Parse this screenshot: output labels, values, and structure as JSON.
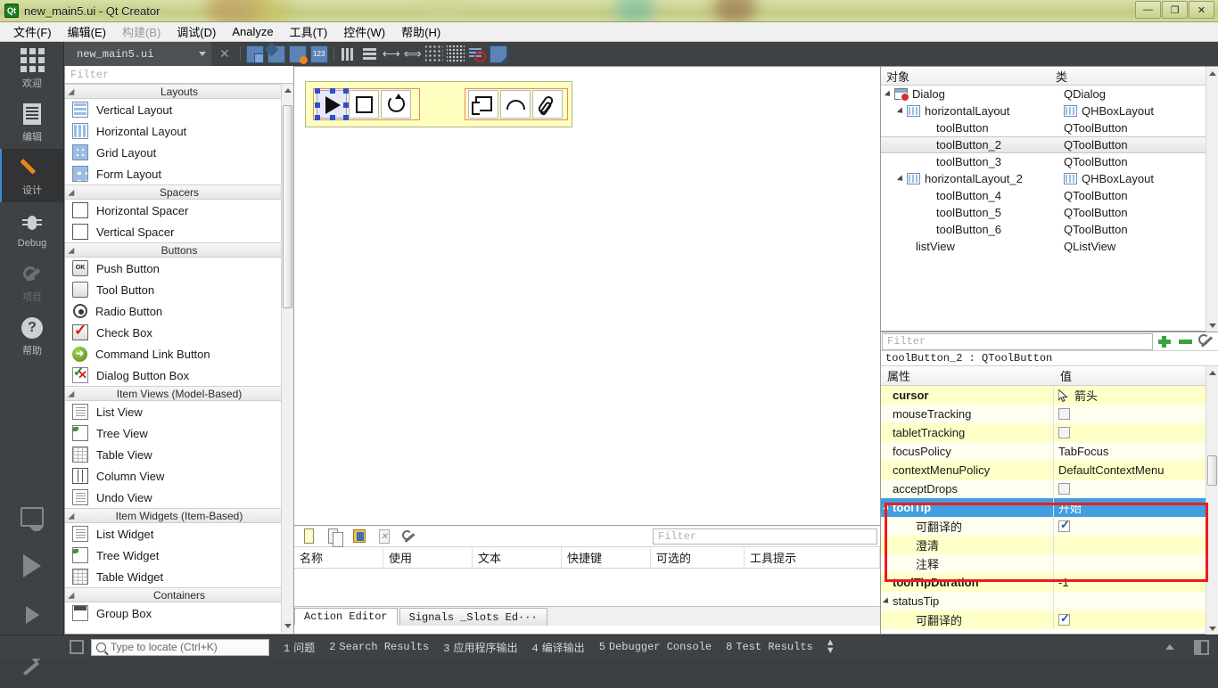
{
  "window": {
    "title": "new_main5.ui - Qt Creator",
    "app_icon_text": "Qt",
    "buttons": [
      {
        "name": "minimize",
        "glyph": "—"
      },
      {
        "name": "restore",
        "glyph": "❐"
      },
      {
        "name": "close",
        "glyph": "✕"
      }
    ]
  },
  "menubar": {
    "items": [
      {
        "label": "文件(F)",
        "disabled": false
      },
      {
        "label": "编辑(E)",
        "disabled": false
      },
      {
        "label": "构建(B)",
        "disabled": true
      },
      {
        "label": "调试(D)",
        "disabled": false
      },
      {
        "label": "Analyze",
        "disabled": false
      },
      {
        "label": "工具(T)",
        "disabled": false
      },
      {
        "label": "控件(W)",
        "disabled": false
      },
      {
        "label": "帮助(H)",
        "disabled": false
      }
    ]
  },
  "modebar": {
    "items": [
      {
        "label": "欢迎",
        "icon": "grid-icon",
        "active": false,
        "disabled": false
      },
      {
        "label": "编辑",
        "icon": "document-icon",
        "active": false,
        "disabled": false
      },
      {
        "label": "设计",
        "icon": "pencil-icon",
        "active": true,
        "disabled": false
      },
      {
        "label": "Debug",
        "icon": "bug-icon",
        "active": false,
        "disabled": false
      },
      {
        "label": "项目",
        "icon": "wrench-icon",
        "active": false,
        "disabled": true
      },
      {
        "label": "帮助",
        "icon": "question-icon",
        "active": false,
        "disabled": false
      }
    ],
    "run_items": [
      {
        "name": "kit-selector",
        "icon": "monitor-icon"
      },
      {
        "name": "run",
        "icon": "play-icon"
      },
      {
        "name": "debug",
        "icon": "play-bug-icon"
      },
      {
        "name": "build",
        "icon": "hammer-icon"
      }
    ]
  },
  "editor_tabbar": {
    "current_file": "new_main5.ui",
    "close_glyph": "✕",
    "tools": [
      {
        "name": "edit-widgets",
        "icon": "edit-widgets-icon"
      },
      {
        "name": "edit-signals-slots",
        "icon": "signals-slots-icon"
      },
      {
        "name": "edit-buddies",
        "icon": "buddies-icon"
      },
      {
        "name": "edit-tab-order",
        "icon": "tab-order-icon"
      },
      {
        "name": "layout-horizontally",
        "icon": "layout-horizontal-icon"
      },
      {
        "name": "layout-vertically",
        "icon": "layout-vertical-icon"
      },
      {
        "name": "layout-horizontal-splitter",
        "icon": "h-splitter-icon"
      },
      {
        "name": "layout-vertical-splitter",
        "icon": "v-splitter-icon"
      },
      {
        "name": "layout-form",
        "icon": "form-layout-icon"
      },
      {
        "name": "layout-grid",
        "icon": "grid-layout-icon"
      },
      {
        "name": "break-layout",
        "icon": "break-layout-icon"
      },
      {
        "name": "adjust-size",
        "icon": "adjust-size-icon"
      }
    ]
  },
  "widgetbox": {
    "filter_placeholder": "Filter",
    "groups": [
      {
        "title": "Layouts",
        "items": [
          {
            "label": "Vertical Layout",
            "icon": "vertical-layout-icon"
          },
          {
            "label": "Horizontal Layout",
            "icon": "horizontal-layout-icon"
          },
          {
            "label": "Grid Layout",
            "icon": "grid-layout-icon"
          },
          {
            "label": "Form Layout",
            "icon": "form-layout-icon"
          }
        ]
      },
      {
        "title": "Spacers",
        "items": [
          {
            "label": "Horizontal Spacer",
            "icon": "horizontal-spacer-icon"
          },
          {
            "label": "Vertical Spacer",
            "icon": "vertical-spacer-icon"
          }
        ]
      },
      {
        "title": "Buttons",
        "items": [
          {
            "label": "Push Button",
            "icon": "push-button-icon"
          },
          {
            "label": "Tool Button",
            "icon": "tool-button-icon"
          },
          {
            "label": "Radio Button",
            "icon": "radio-button-icon"
          },
          {
            "label": "Check Box",
            "icon": "check-box-icon"
          },
          {
            "label": "Command Link Button",
            "icon": "command-link-icon"
          },
          {
            "label": "Dialog Button Box",
            "icon": "dialog-button-box-icon"
          }
        ]
      },
      {
        "title": "Item Views (Model-Based)",
        "items": [
          {
            "label": "List View",
            "icon": "list-view-icon"
          },
          {
            "label": "Tree View",
            "icon": "tree-view-icon"
          },
          {
            "label": "Table View",
            "icon": "table-view-icon"
          },
          {
            "label": "Column View",
            "icon": "column-view-icon"
          },
          {
            "label": "Undo View",
            "icon": "undo-view-icon"
          }
        ]
      },
      {
        "title": "Item Widgets (Item-Based)",
        "items": [
          {
            "label": "List Widget",
            "icon": "list-widget-icon"
          },
          {
            "label": "Tree Widget",
            "icon": "tree-widget-icon"
          },
          {
            "label": "Table Widget",
            "icon": "table-widget-icon"
          }
        ]
      },
      {
        "title": "Containers",
        "items": [
          {
            "label": "Group Box",
            "icon": "group-box-icon"
          }
        ]
      }
    ]
  },
  "form": {
    "group1": [
      {
        "name": "toolButton",
        "icon": "play-icon",
        "selected": true
      },
      {
        "name": "toolButton_2",
        "icon": "stop-square-icon",
        "selected": false
      },
      {
        "name": "toolButton_3",
        "icon": "reload-icon",
        "selected": false
      }
    ],
    "group2": [
      {
        "name": "toolButton_4",
        "icon": "window-icon",
        "selected": false
      },
      {
        "name": "toolButton_5",
        "icon": "cloud-icon",
        "selected": false
      },
      {
        "name": "toolButton_6",
        "icon": "paperclip-icon",
        "selected": false
      }
    ]
  },
  "object_inspector": {
    "headers": [
      "对象",
      "类"
    ],
    "rows": [
      {
        "object": "Dialog",
        "class": "QDialog",
        "indent": 0,
        "expandable": true,
        "icon": "dialog-icon",
        "class_icon": "",
        "selected": false
      },
      {
        "object": "horizontalLayout",
        "class": "QHBoxLayout",
        "indent": 1,
        "expandable": true,
        "icon": "hbox-icon",
        "class_icon": "hbox-icon",
        "selected": false
      },
      {
        "object": "toolButton",
        "class": "QToolButton",
        "indent": 2,
        "expandable": false,
        "icon": "",
        "class_icon": "",
        "selected": false
      },
      {
        "object": "toolButton_2",
        "class": "QToolButton",
        "indent": 2,
        "expandable": false,
        "icon": "",
        "class_icon": "",
        "selected": true
      },
      {
        "object": "toolButton_3",
        "class": "QToolButton",
        "indent": 2,
        "expandable": false,
        "icon": "",
        "class_icon": "",
        "selected": false
      },
      {
        "object": "horizontalLayout_2",
        "class": "QHBoxLayout",
        "indent": 1,
        "expandable": true,
        "icon": "hbox-icon",
        "class_icon": "hbox-icon",
        "selected": false
      },
      {
        "object": "toolButton_4",
        "class": "QToolButton",
        "indent": 2,
        "expandable": false,
        "icon": "",
        "class_icon": "",
        "selected": false
      },
      {
        "object": "toolButton_5",
        "class": "QToolButton",
        "indent": 2,
        "expandable": false,
        "icon": "",
        "class_icon": "",
        "selected": false
      },
      {
        "object": "toolButton_6",
        "class": "QToolButton",
        "indent": 2,
        "expandable": false,
        "icon": "",
        "class_icon": "",
        "selected": false
      },
      {
        "object": "listView",
        "class": "QListView",
        "indent": 1,
        "expandable": false,
        "icon": "",
        "class_icon": "",
        "selected": false
      }
    ]
  },
  "property_editor": {
    "filter_placeholder": "Filter",
    "object_line": "toolButton_2 : QToolButton",
    "headers": [
      "属性",
      "值"
    ],
    "toolbar": [
      {
        "name": "add-property",
        "icon": "plus-icon"
      },
      {
        "name": "remove-property",
        "icon": "minus-icon"
      },
      {
        "name": "configure",
        "icon": "wrench-icon"
      }
    ],
    "rows": [
      {
        "name": "cursor",
        "value": "箭头",
        "indent": 0,
        "bold": true,
        "expandable": false,
        "type": "cursor",
        "band": "yellow"
      },
      {
        "name": "mouseTracking",
        "value": "",
        "indent": 0,
        "bold": false,
        "expandable": false,
        "type": "checkbox",
        "checked": false,
        "band": "pale"
      },
      {
        "name": "tabletTracking",
        "value": "",
        "indent": 0,
        "bold": false,
        "expandable": false,
        "type": "checkbox",
        "checked": false,
        "band": "yellow"
      },
      {
        "name": "focusPolicy",
        "value": "TabFocus",
        "indent": 0,
        "bold": false,
        "expandable": false,
        "type": "text",
        "band": "pale"
      },
      {
        "name": "contextMenuPolicy",
        "value": "DefaultContextMenu",
        "indent": 0,
        "bold": false,
        "expandable": false,
        "type": "text",
        "band": "yellow"
      },
      {
        "name": "acceptDrops",
        "value": "",
        "indent": 0,
        "bold": false,
        "expandable": false,
        "type": "checkbox",
        "checked": false,
        "band": "pale"
      },
      {
        "name": "toolTip",
        "value": "开始",
        "indent": 0,
        "bold": true,
        "expandable": true,
        "type": "text",
        "band": "selected"
      },
      {
        "name": "可翻译的",
        "value": "",
        "indent": 1,
        "bold": false,
        "expandable": false,
        "type": "checkbox",
        "checked": true,
        "band": "pale"
      },
      {
        "name": "澄清",
        "value": "",
        "indent": 1,
        "bold": false,
        "expandable": false,
        "type": "text",
        "band": "yellow"
      },
      {
        "name": "注释",
        "value": "",
        "indent": 1,
        "bold": false,
        "expandable": false,
        "type": "text",
        "band": "pale"
      },
      {
        "name": "toolTipDuration",
        "value": "-1",
        "indent": 0,
        "bold": true,
        "expandable": false,
        "type": "text",
        "band": "yellow"
      },
      {
        "name": "statusTip",
        "value": "",
        "indent": 0,
        "bold": false,
        "expandable": true,
        "type": "text",
        "band": "pale"
      },
      {
        "name": "可翻译的",
        "value": "",
        "indent": 1,
        "bold": false,
        "expandable": false,
        "type": "checkbox",
        "checked": true,
        "band": "yellow"
      }
    ],
    "highlight_color": "#ee1c1c",
    "selection_color": "#3f9fe0"
  },
  "action_editor": {
    "filter_placeholder": "Filter",
    "toolbar": [
      {
        "name": "new-action",
        "icon": "new-file-icon"
      },
      {
        "name": "copy-action",
        "icon": "copy-icon"
      },
      {
        "name": "edit-action",
        "icon": "edit-icon"
      },
      {
        "name": "delete-action",
        "icon": "delete-icon"
      },
      {
        "name": "view-options",
        "icon": "wrench-icon"
      }
    ],
    "headers": [
      "名称",
      "使用",
      "文本",
      "快捷键",
      "可选的",
      "工具提示"
    ],
    "rows": [],
    "tabs": [
      {
        "label": "Action Editor",
        "active": true
      },
      {
        "label": "Signals _Slots Ed···",
        "active": false
      }
    ]
  },
  "statusbar": {
    "locator_placeholder": "Type to locate (Ctrl+K)",
    "outputs": [
      {
        "num": "1",
        "label": "问题"
      },
      {
        "num": "2",
        "label": "Search Results"
      },
      {
        "num": "3",
        "label": "应用程序输出"
      },
      {
        "num": "4",
        "label": "编译输出"
      },
      {
        "num": "5",
        "label": "Debugger Console"
      },
      {
        "num": "8",
        "label": "Test Results"
      }
    ]
  }
}
